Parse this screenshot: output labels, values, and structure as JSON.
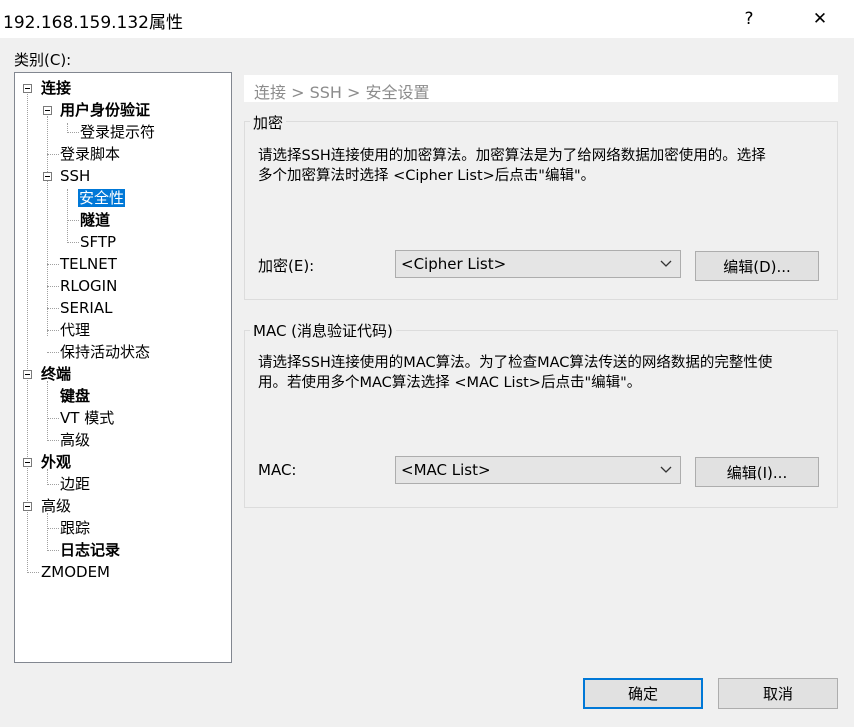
{
  "window": {
    "title": "192.168.159.132属性",
    "help_glyph": "?",
    "close_glyph": "✕"
  },
  "category_label": "类别(C):",
  "tree": {
    "connect": "连接",
    "user_auth": "用户身份验证",
    "login_prompt": "登录提示符",
    "login_script": "登录脚本",
    "ssh": "SSH",
    "security": "安全性",
    "tunnel": "隧道",
    "sftp": "SFTP",
    "telnet": "TELNET",
    "rlogin": "RLOGIN",
    "serial": "SERIAL",
    "proxy": "代理",
    "keepalive": "保持活动状态",
    "terminal": "终端",
    "keyboard": "键盘",
    "vt_mode": "VT 模式",
    "advanced_term": "高级",
    "appearance": "外观",
    "margin": "边距",
    "advanced": "高级",
    "trace": "跟踪",
    "logging": "日志记录",
    "zmodem": "ZMODEM"
  },
  "breadcrumb": "连接 > SSH > 安全设置",
  "encryption": {
    "legend": "加密",
    "desc_line1": "请选择SSH连接使用的加密算法。加密算法是为了给网络数据加密使用的。选择",
    "desc_line2": "多个加密算法时选择 <Cipher List>后点击\"编辑\"。",
    "label": "加密(E):",
    "value": "<Cipher List>",
    "edit_button": "编辑(D)..."
  },
  "mac": {
    "legend": "MAC (消息验证代码)",
    "desc_line1": "请选择SSH连接使用的MAC算法。为了检查MAC算法传送的网络数据的完整性使",
    "desc_line2": "用。若使用多个MAC算法选择 <MAC List>后点击\"编辑\"。",
    "label": "MAC:",
    "value": "<MAC List>",
    "edit_button": "编辑(I)..."
  },
  "footer": {
    "ok": "确定",
    "cancel": "取消"
  },
  "colors": {
    "selection": "#0078d7",
    "default_button_border": "#0078d7"
  }
}
